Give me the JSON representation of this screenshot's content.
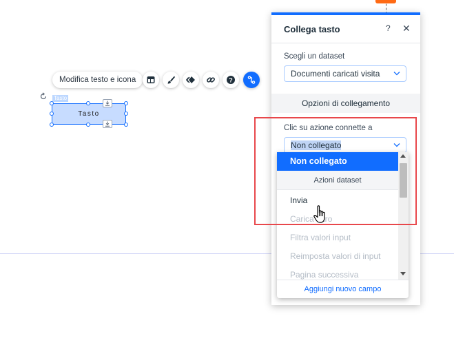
{
  "toolbar": {
    "edit_label": "Modifica testo e icona",
    "buttons": [
      "layout-icon",
      "brush-icon",
      "animation-icon",
      "link-icon",
      "help-icon",
      "connect-data-icon"
    ]
  },
  "element": {
    "tag": "Tasto",
    "text": "Tasto"
  },
  "panel": {
    "title": "Collega tasto",
    "help": "?",
    "close": "✕",
    "dataset_label": "Scegli un dataset",
    "dataset_value": "Documenti caricati visita",
    "section_title": "Opzioni di collegamento",
    "action_label": "Clic su azione connette a",
    "action_value": "Non collegato"
  },
  "dropdown": {
    "selected": "Non collegato",
    "group": "Azioni dataset",
    "items": [
      {
        "label": "Invia",
        "enabled": true
      },
      {
        "label": "Carica altro",
        "enabled": false
      },
      {
        "label": "Filtra valori input",
        "enabled": false
      },
      {
        "label": "Reimposta valori di input",
        "enabled": false
      },
      {
        "label": "Pagina successiva",
        "enabled": false
      }
    ],
    "footer": "Aggiungi nuovo campo"
  },
  "colors": {
    "accent": "#116dff",
    "highlight": "#e8474b",
    "orange": "#ff6a14"
  }
}
